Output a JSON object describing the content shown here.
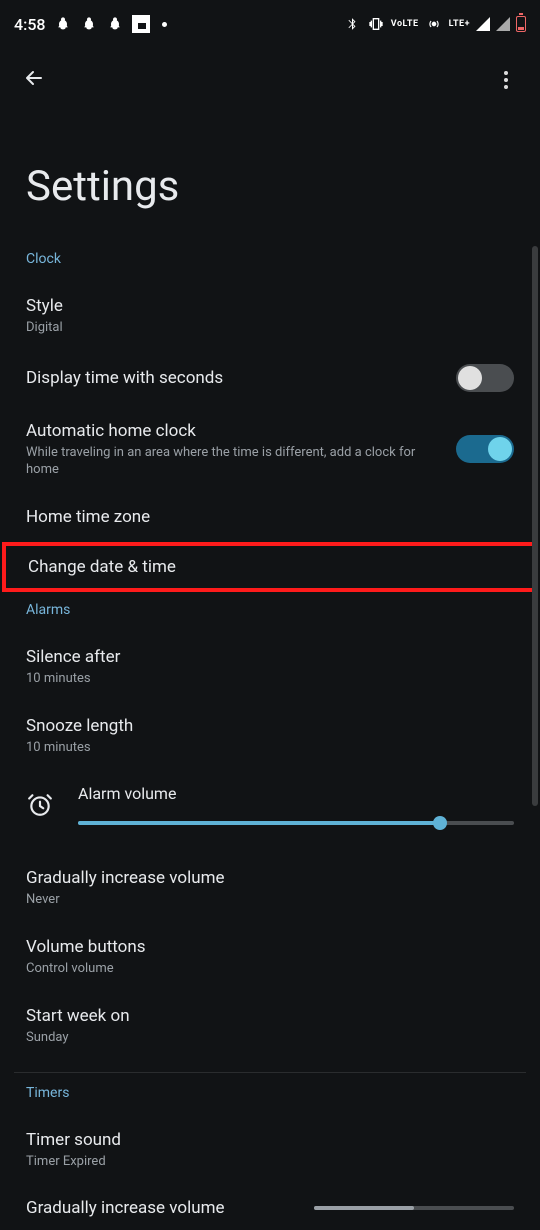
{
  "status": {
    "time": "4:58",
    "lte_label": "LTE+",
    "volte_label": "VoLTE"
  },
  "toolbar": {
    "back_name": "back",
    "more_name": "more-options"
  },
  "page": {
    "title": "Settings"
  },
  "sections": {
    "clock": {
      "header": "Clock",
      "style": {
        "title": "Style",
        "value": "Digital"
      },
      "seconds": {
        "title": "Display time with seconds",
        "on": false
      },
      "auto_home": {
        "title": "Automatic home clock",
        "desc": "While traveling in an area where the time is different, add a clock for home",
        "on": true
      },
      "home_tz": {
        "title": "Home time zone"
      },
      "change_dt": {
        "title": "Change date & time"
      }
    },
    "alarms": {
      "header": "Alarms",
      "silence": {
        "title": "Silence after",
        "value": "10 minutes"
      },
      "snooze": {
        "title": "Snooze length",
        "value": "10 minutes"
      },
      "volume": {
        "title": "Alarm volume",
        "percent": 83
      },
      "grad_vol": {
        "title": "Gradually increase volume",
        "value": "Never"
      },
      "vol_buttons": {
        "title": "Volume buttons",
        "value": "Control volume"
      },
      "week_start": {
        "title": "Start week on",
        "value": "Sunday"
      }
    },
    "timers": {
      "header": "Timers",
      "sound": {
        "title": "Timer sound",
        "value": "Timer Expired"
      },
      "grad_vol": {
        "title": "Gradually increase volume",
        "percent": 50
      }
    }
  }
}
